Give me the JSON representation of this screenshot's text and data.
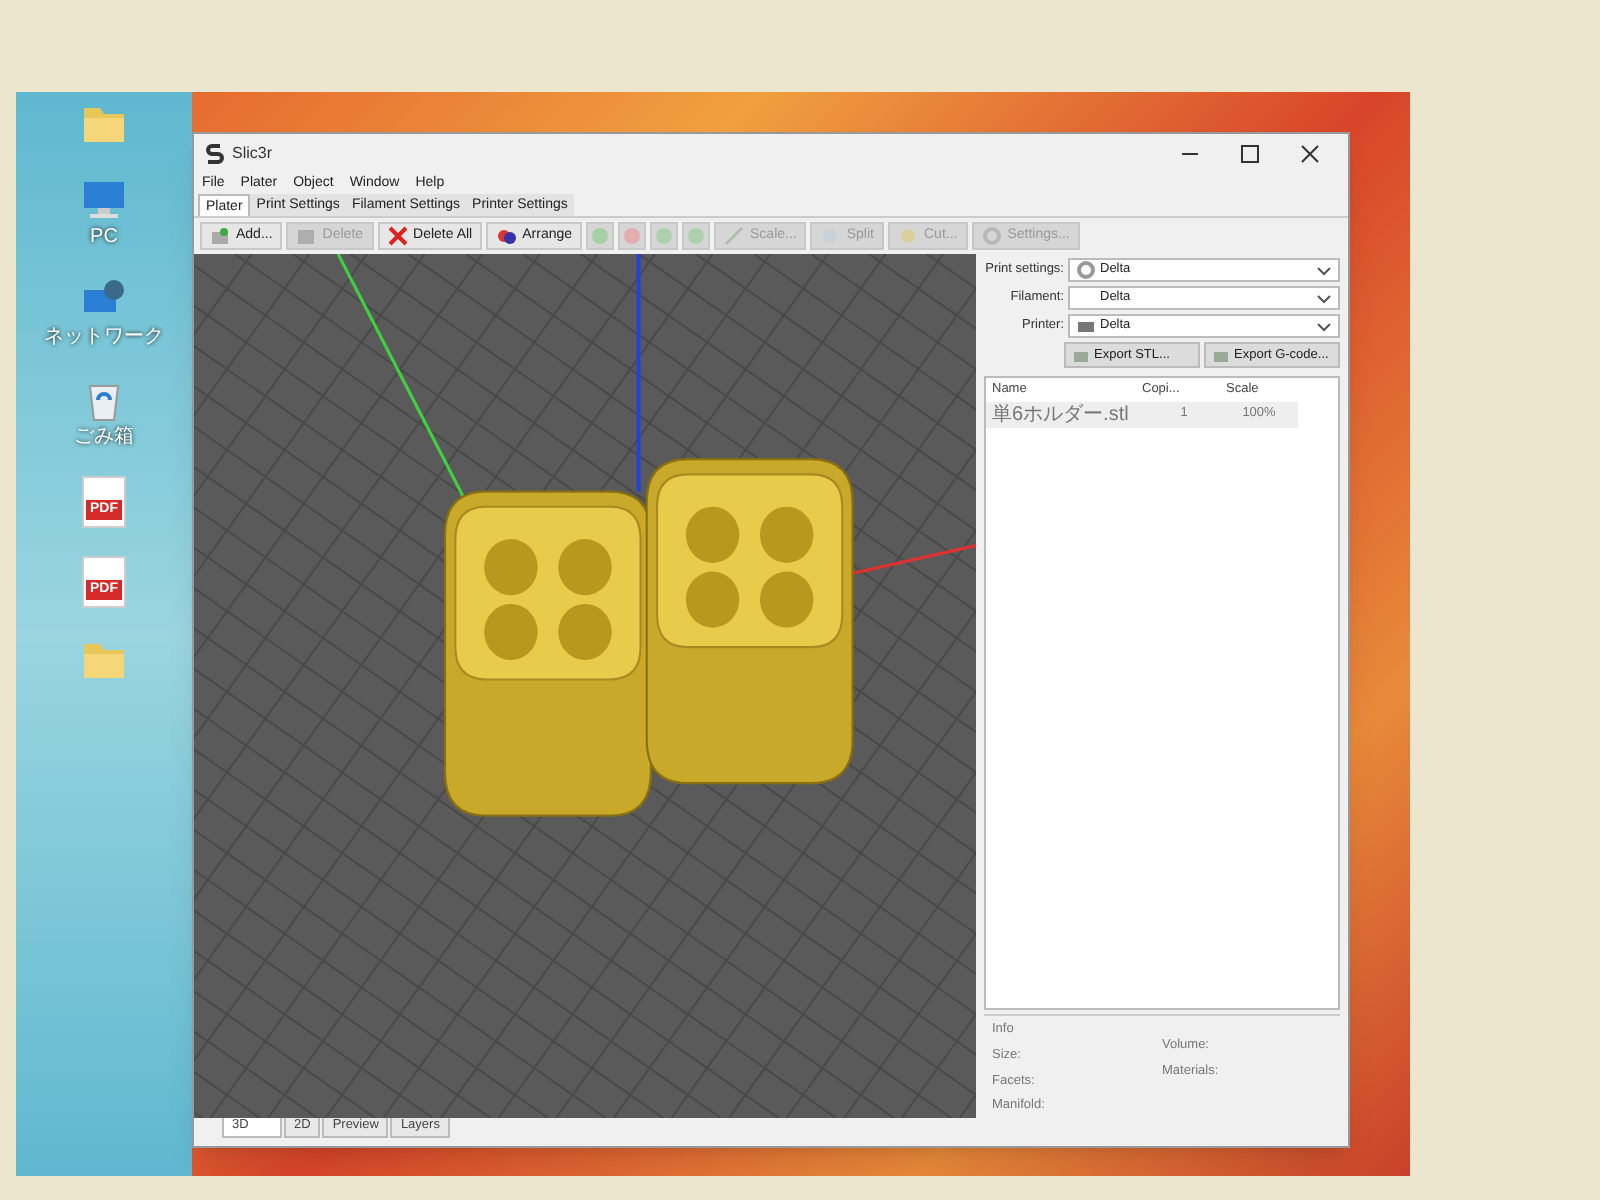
{
  "desktop_icons": [
    {
      "kind": "folder"
    },
    {
      "kind": "pc",
      "label": "PC"
    },
    {
      "kind": "network",
      "label": "ネットワーク"
    },
    {
      "kind": "trash",
      "label": "ごみ箱"
    },
    {
      "kind": "pdf",
      "badge": "PDF"
    },
    {
      "kind": "pdf",
      "badge": "PDF"
    },
    {
      "kind": "folder"
    }
  ],
  "window": {
    "title": "Slic3r"
  },
  "menu": [
    "File",
    "Plater",
    "Object",
    "Window",
    "Help"
  ],
  "tabs": [
    {
      "label": "Plater",
      "selected": true
    },
    {
      "label": "Print Settings",
      "selected": false
    },
    {
      "label": "Filament Settings",
      "selected": false
    },
    {
      "label": "Printer Settings",
      "selected": false
    }
  ],
  "toolbar": [
    {
      "kind": "text",
      "label": "Add...",
      "disabled": false
    },
    {
      "kind": "text",
      "label": "Delete",
      "disabled": true
    },
    {
      "kind": "text",
      "label": "Delete All",
      "disabled": false
    },
    {
      "kind": "text",
      "label": "Arrange",
      "disabled": false
    },
    {
      "kind": "small",
      "disabled": true
    },
    {
      "kind": "small",
      "disabled": true
    },
    {
      "kind": "small",
      "disabled": true
    },
    {
      "kind": "small",
      "disabled": true
    },
    {
      "kind": "text",
      "label": "Scale...",
      "disabled": true
    },
    {
      "kind": "text",
      "label": "Split",
      "disabled": true
    },
    {
      "kind": "text",
      "label": "Cut...",
      "disabled": true
    },
    {
      "kind": "text",
      "label": "Settings...",
      "disabled": true
    }
  ],
  "settings": [
    {
      "label": "Print settings:",
      "value": "Delta"
    },
    {
      "label": "Filament:",
      "value": "Delta"
    },
    {
      "label": "Printer:",
      "value": "Delta"
    }
  ],
  "export_buttons": [
    "Export STL...",
    "Export G-code..."
  ],
  "objects_table": {
    "columns": [
      "Name",
      "Copi...",
      "Scale"
    ],
    "rows": [
      {
        "cells": [
          "単6ホルダー.stl",
          "1",
          "100%"
        ],
        "selected": false
      }
    ]
  },
  "info": {
    "title": "Info",
    "left": [
      "Size:",
      "Facets:",
      "Manifold:"
    ],
    "right": [
      "Volume:",
      "Materials:"
    ]
  },
  "view_tabs": [
    {
      "label": "3D",
      "selected": true
    },
    {
      "label": "2D",
      "selected": false
    },
    {
      "label": "Preview",
      "selected": false
    },
    {
      "label": "Layers",
      "selected": false
    }
  ]
}
